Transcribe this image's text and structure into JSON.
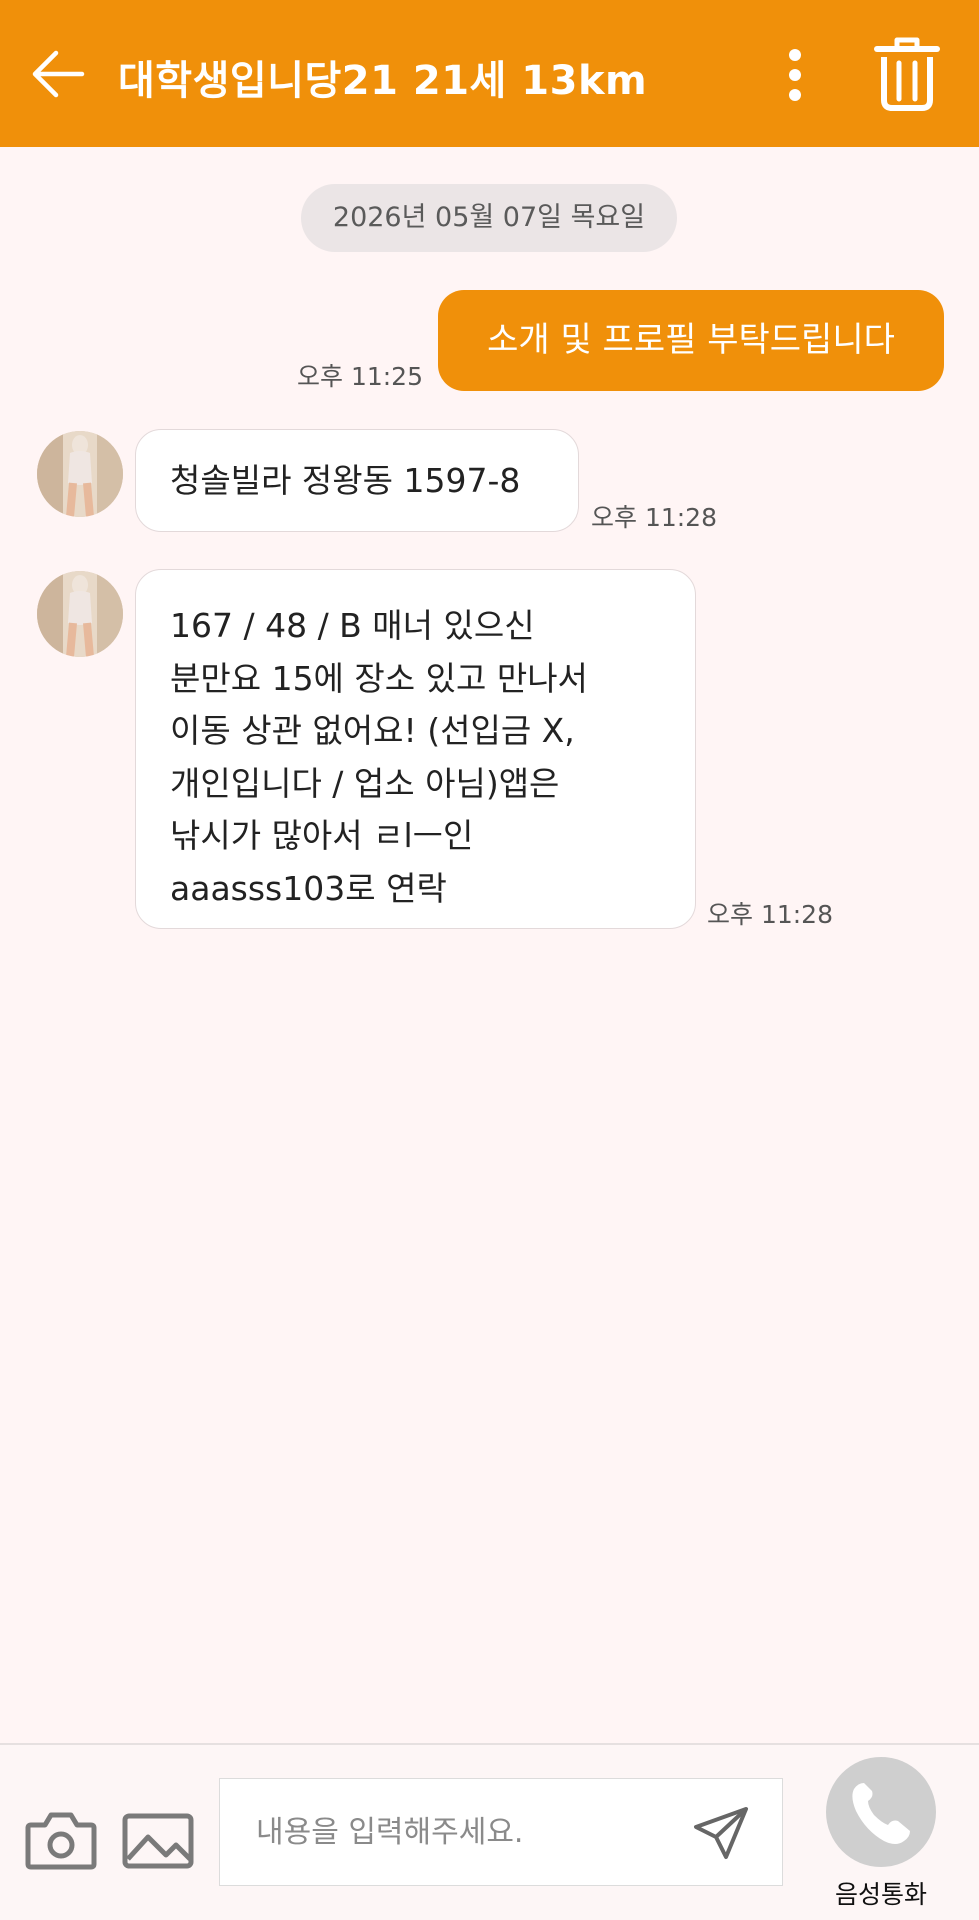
{
  "header": {
    "title": "대학생입니당21 21세 13km",
    "icons": {
      "back": "arrow-left-icon",
      "more": "more-vertical-icon",
      "delete": "trash-icon"
    }
  },
  "chat": {
    "date_separator": "2026년 05월 07일 목요일",
    "messages": [
      {
        "direction": "outgoing",
        "text": "소개 및 프로필 부탁드립니다",
        "time": "오후 11:25"
      },
      {
        "direction": "incoming",
        "text": "청솔빌라 정왕동 1597-8",
        "time": "오후 11:28"
      },
      {
        "direction": "incoming",
        "lines": [
          "167 / 48 / B 매너 있으신",
          "분만요 15에 장소 있고 만나서",
          "이동 상관 없어요! (선입금 X,",
          "개인입니다 / 업소 아님)앱은",
          "낚시가 많아서 ㄹlㅡ인",
          "aaasss103로 연락"
        ],
        "time": "오후 11:28"
      }
    ]
  },
  "composer": {
    "placeholder": "내용을 입력해주세요.",
    "value": "",
    "call_label": "음성통화",
    "icons": {
      "camera": "camera-icon",
      "gallery": "image-icon",
      "send": "send-icon",
      "call": "phone-icon"
    }
  },
  "colors": {
    "accent": "#f0900a",
    "background": "#fff5f5",
    "incoming_bubble": "#ffffff",
    "date_pill": "#ebe5e6"
  }
}
